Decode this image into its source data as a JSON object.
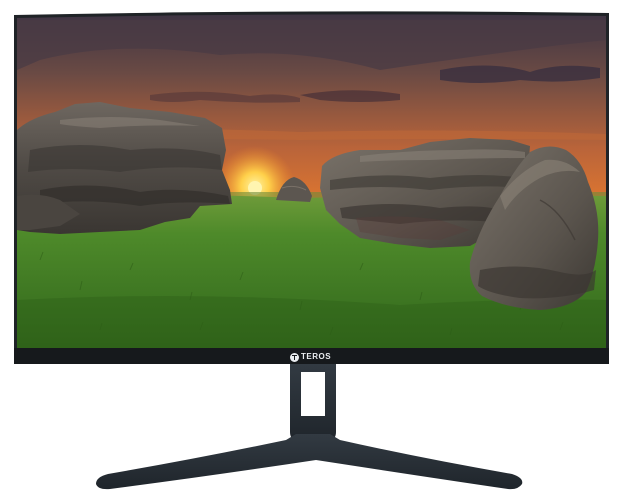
{
  "brand": {
    "logo_text": "TEROS",
    "logo_icon": "teros-t-logo-icon"
  },
  "colors": {
    "frame": "#1f2327",
    "bezel_bottom": "#16191c",
    "stand": "#2a3138",
    "sky_top": "#3b3340",
    "sky_glow": "#f07a2a",
    "sun": "#ffc93a",
    "grass": "#3f7a22",
    "rock": "#5c5650"
  },
  "scene": {
    "description_icon": "landscape-wallpaper",
    "elements": [
      "sunset-sky",
      "sun",
      "rock-formation-left",
      "rock-small-distant",
      "rock-formation-right",
      "boulder-right",
      "grass-field"
    ]
  }
}
